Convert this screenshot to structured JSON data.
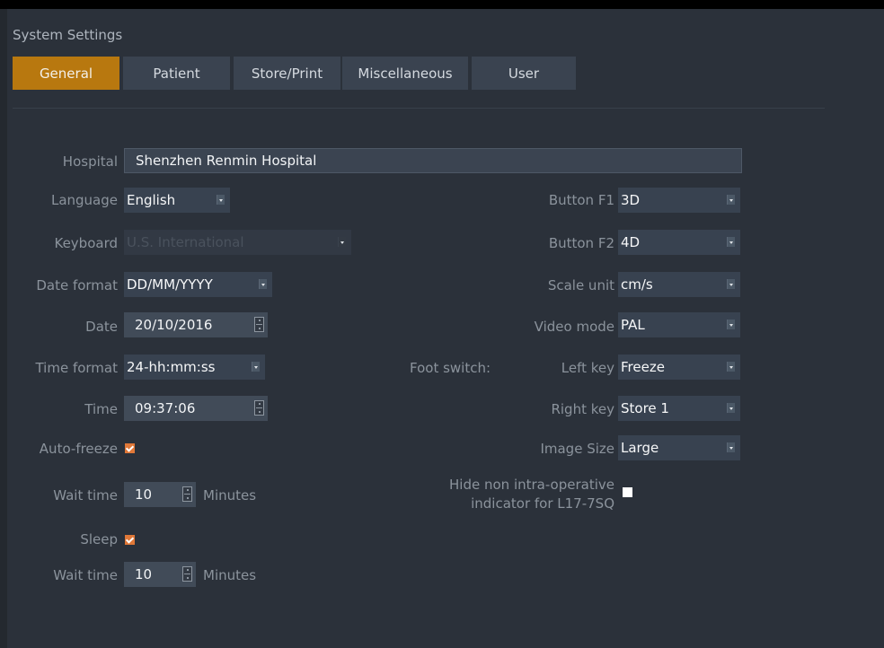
{
  "window": {
    "title": "System Settings"
  },
  "tabs": [
    {
      "label": "General",
      "active": true
    },
    {
      "label": "Patient",
      "active": false
    },
    {
      "label": "Store/Print",
      "active": false
    },
    {
      "label": "Miscellaneous",
      "active": false
    },
    {
      "label": "User",
      "active": false
    }
  ],
  "left": {
    "hospital": {
      "label": "Hospital",
      "value": "Shenzhen Renmin Hospital"
    },
    "language": {
      "label": "Language",
      "value": "English"
    },
    "keyboard": {
      "label": "Keyboard",
      "value": "U.S. International",
      "disabled": true
    },
    "date_format": {
      "label": "Date format",
      "value": "DD/MM/YYYY"
    },
    "date": {
      "label": "Date",
      "value": "20/10/2016"
    },
    "time_format": {
      "label": "Time format",
      "value": "24-hh:mm:ss"
    },
    "time": {
      "label": "Time",
      "value": "09:37:06"
    },
    "auto_freeze": {
      "label": "Auto-freeze",
      "checked": true
    },
    "auto_freeze_wait": {
      "label": "Wait time",
      "value": "10",
      "unit": "Minutes"
    },
    "sleep": {
      "label": "Sleep",
      "checked": true
    },
    "sleep_wait": {
      "label": "Wait time",
      "value": "10",
      "unit": "Minutes"
    }
  },
  "right": {
    "button_f1": {
      "label": "Button F1",
      "value": "3D"
    },
    "button_f2": {
      "label": "Button F2",
      "value": "4D"
    },
    "scale_unit": {
      "label": "Scale unit",
      "value": "cm/s"
    },
    "video_mode": {
      "label": "Video mode",
      "value": "PAL"
    },
    "foot_switch_label": "Foot switch:",
    "left_key": {
      "label": "Left key",
      "value": "Freeze"
    },
    "right_key": {
      "label": "Right key",
      "value": "Store 1"
    },
    "image_size": {
      "label": "Image Size",
      "value": "Large"
    },
    "hide_indicator": {
      "label_line1": "Hide non intra-operative",
      "label_line2": "indicator for L17-7SQ",
      "checked": false
    }
  },
  "colors": {
    "accent": "#b8780f",
    "checkbox": "#e07838",
    "background": "#2b313a"
  }
}
